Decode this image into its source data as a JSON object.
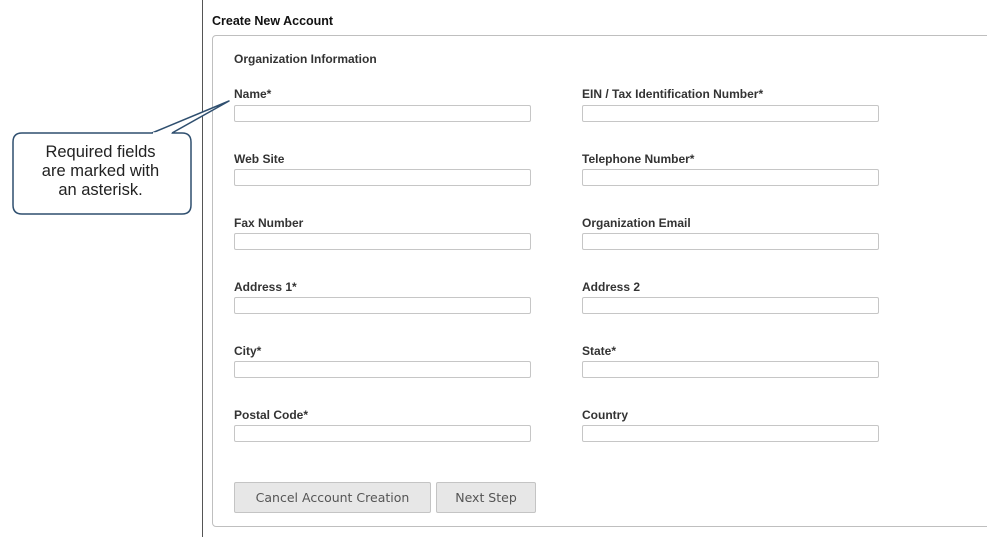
{
  "page": {
    "title": "Create New Account",
    "section_title": "Organization Information"
  },
  "form": {
    "fields": [
      {
        "label": "Name*",
        "value": ""
      },
      {
        "label": "EIN / Tax Identification Number*",
        "value": ""
      },
      {
        "label": "Web Site",
        "value": ""
      },
      {
        "label": "Telephone Number*",
        "value": ""
      },
      {
        "label": "Fax Number",
        "value": ""
      },
      {
        "label": "Organization Email",
        "value": ""
      },
      {
        "label": "Address 1*",
        "value": ""
      },
      {
        "label": "Address 2",
        "value": ""
      },
      {
        "label": "City*",
        "value": ""
      },
      {
        "label": "State*",
        "value": ""
      },
      {
        "label": "Postal Code*",
        "value": ""
      },
      {
        "label": "Country",
        "value": ""
      }
    ],
    "buttons": {
      "cancel_label": "Cancel Account Creation",
      "next_label": "Next Step"
    }
  },
  "callout": {
    "lines": [
      "Required fields",
      "are marked with",
      "an asterisk."
    ]
  },
  "colors": {
    "input_border": "#c6c6c6",
    "button_bg": "#e7e7e7",
    "callout_border": "#2f4f6f"
  }
}
